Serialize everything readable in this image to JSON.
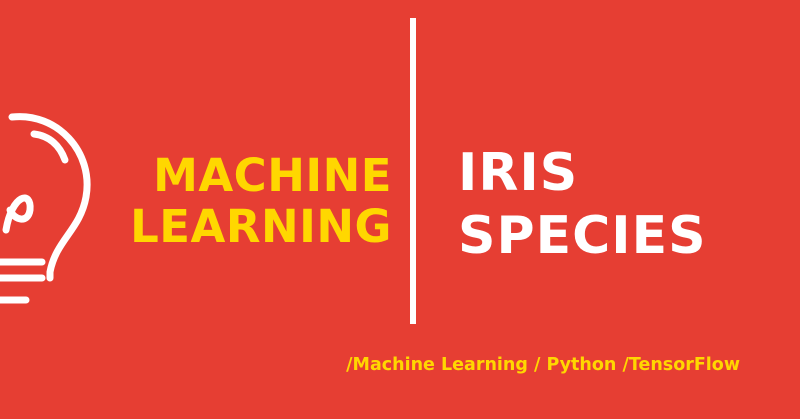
{
  "banner": {
    "left_title": [
      "MACHINE",
      "LEARNING"
    ],
    "right_title": [
      "IRIS",
      "SPECIES"
    ],
    "tags": "/Machine Learning / Python /TensorFlow",
    "icon": "lightbulb-icon"
  },
  "colors": {
    "background": "#e63e33",
    "accent_yellow": "#ffd700",
    "white": "#ffffff"
  }
}
